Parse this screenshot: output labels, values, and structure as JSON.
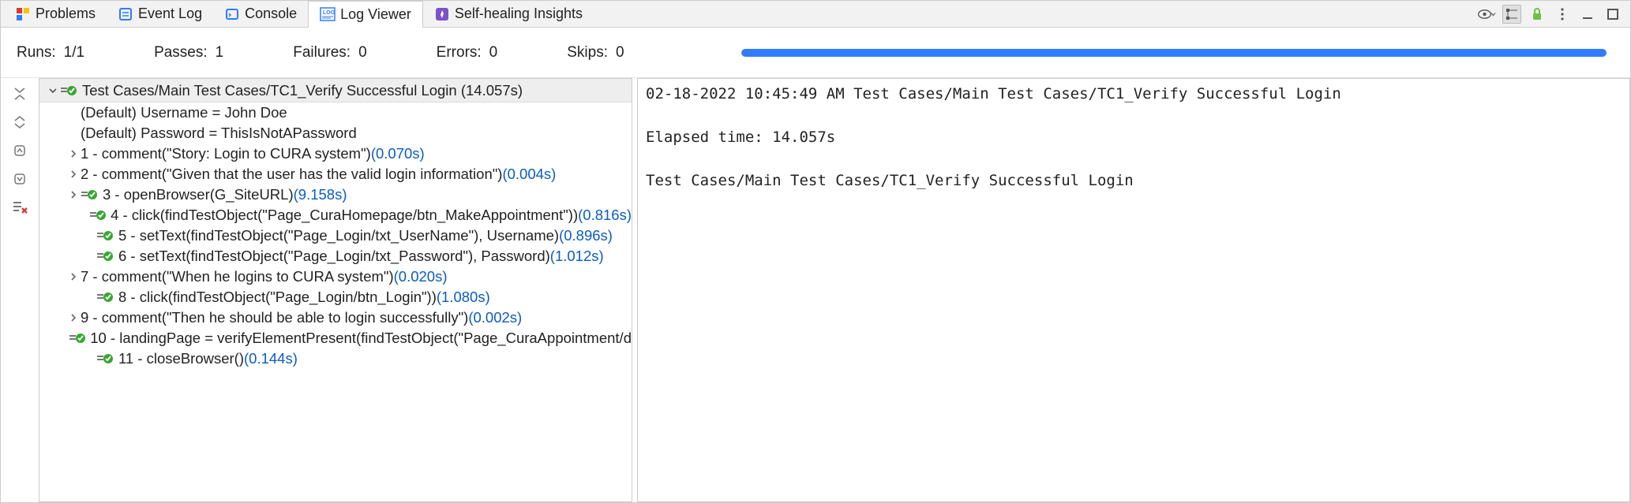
{
  "tabs": [
    {
      "label": "Problems",
      "icon": "problems-icon"
    },
    {
      "label": "Event Log",
      "icon": "eventlog-icon"
    },
    {
      "label": "Console",
      "icon": "console-icon"
    },
    {
      "label": "Log Viewer",
      "icon": "logviewer-icon",
      "active": true
    },
    {
      "label": "Self-healing Insights",
      "icon": "selfhealing-icon"
    }
  ],
  "summary": {
    "runs_label": "Runs:",
    "runs_value": "1/1",
    "passes_label": "Passes:",
    "passes_value": "1",
    "failures_label": "Failures:",
    "failures_value": "0",
    "errors_label": "Errors:",
    "errors_value": "0",
    "skips_label": "Skips:",
    "skips_value": "0",
    "progress_percent": 100
  },
  "tree": {
    "header": {
      "label": "Test Cases/Main Test Cases/TC1_Verify Successful Login",
      "duration": "(14.057s)"
    },
    "rows": [
      {
        "indent": 1,
        "expander": "",
        "icon": "",
        "text": "(Default) Username = John Doe",
        "time": ""
      },
      {
        "indent": 1,
        "expander": "",
        "icon": "",
        "text": "(Default) Password = ThisIsNotAPassword",
        "time": ""
      },
      {
        "indent": 1,
        "expander": ">",
        "icon": "",
        "text": "1 - comment(\"Story: Login to CURA system\")",
        "time": "(0.070s)"
      },
      {
        "indent": 1,
        "expander": ">",
        "icon": "",
        "text": "2 - comment(\"Given that the user has the valid login information\")",
        "time": "(0.004s)"
      },
      {
        "indent": 1,
        "expander": ">",
        "icon": "pass",
        "text": "3 - openBrowser(G_SiteURL)",
        "time": "(9.158s)"
      },
      {
        "indent": 2,
        "expander": "",
        "icon": "pass",
        "text": "4 - click(findTestObject(\"Page_CuraHomepage/btn_MakeAppointment\"))",
        "time": "(0.816s)"
      },
      {
        "indent": 2,
        "expander": "",
        "icon": "pass",
        "text": "5 - setText(findTestObject(\"Page_Login/txt_UserName\"), Username)",
        "time": "(0.896s)"
      },
      {
        "indent": 2,
        "expander": "",
        "icon": "pass",
        "text": "6 - setText(findTestObject(\"Page_Login/txt_Password\"), Password)",
        "time": "(1.012s)"
      },
      {
        "indent": 1,
        "expander": ">",
        "icon": "",
        "text": "7 - comment(\"When he logins to CURA system\")",
        "time": "(0.020s)"
      },
      {
        "indent": 2,
        "expander": "",
        "icon": "pass",
        "text": "8 - click(findTestObject(\"Page_Login/btn_Login\"))",
        "time": "(1.080s)"
      },
      {
        "indent": 1,
        "expander": ">",
        "icon": "",
        "text": "9 - comment(\"Then he should be able to login successfully\")",
        "time": "(0.002s)"
      },
      {
        "indent": 2,
        "expander": "",
        "icon": "pass",
        "text": "10 - landingPage = verifyElementPresent(findTestObject(\"Page_CuraAppointment/d",
        "time": ""
      },
      {
        "indent": 2,
        "expander": "",
        "icon": "pass",
        "text": "11 - closeBrowser()",
        "time": "(0.144s)"
      }
    ]
  },
  "log": {
    "line1": "02-18-2022 10:45:49 AM Test Cases/Main Test Cases/TC1_Verify Successful Login",
    "line2": "Elapsed time: 14.057s",
    "line3": "Test Cases/Main Test Cases/TC1_Verify Successful Login"
  }
}
